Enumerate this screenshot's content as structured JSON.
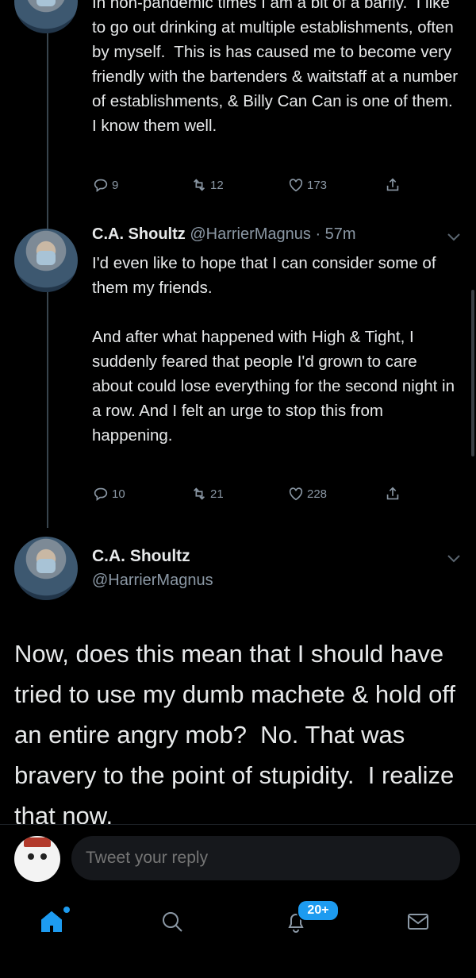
{
  "tweet1": {
    "text": "In non-pandemic times I am a bit of a barfly.  I like to go out drinking at multiple establishments, often by myself.  This is has caused me to become very friendly with the bartenders & waitstaff at a number of establishments, & Billy Can Can is one of them.  I know them well.",
    "replies": "9",
    "retweets": "12",
    "likes": "173"
  },
  "tweet2": {
    "name": "C.A. Shoultz",
    "handle": "@HarrierMagnus",
    "time": "· 57m",
    "text": "I'd even like to hope that I can consider some of them my friends.\n\nAnd after what happened with High & Tight, I suddenly feared that people I'd grown to care about could lose everything for the second night in a row. And I felt an urge to stop this from happening.",
    "replies": "10",
    "retweets": "21",
    "likes": "228"
  },
  "main_tweet": {
    "name": "C.A. Shoultz",
    "handle": "@HarrierMagnus",
    "text": "Now, does this mean that I should have tried to use my dumb machete & hold off an entire angry mob?  No. That was bravery to the point of stupidity.  I realize that now."
  },
  "reply": {
    "placeholder": "Tweet your reply"
  },
  "tabbar": {
    "notifications_badge": "20+"
  },
  "colors": {
    "accent": "#1d9bf0",
    "muted": "#8b98a5",
    "text": "#e7e9ea"
  }
}
